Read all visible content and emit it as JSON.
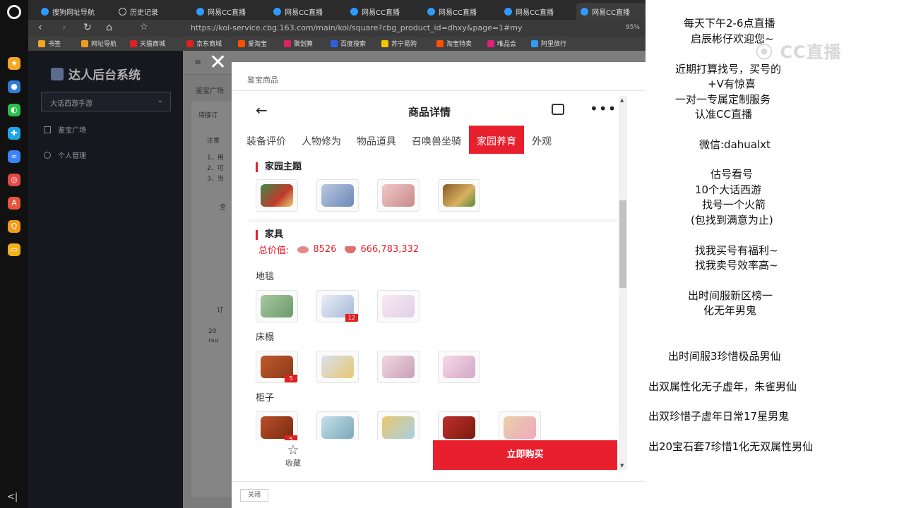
{
  "dock": {
    "apps": [
      {
        "name": "app-orange-icon",
        "color": "#f5a623"
      },
      {
        "name": "app-blue-icon",
        "color": "#2f7dd8"
      },
      {
        "name": "app-wechat-icon",
        "color": "#2bbf4b"
      },
      {
        "name": "app-cyan-icon",
        "color": "#1ea7e8"
      },
      {
        "name": "app-blue2-icon",
        "color": "#3b82f6"
      },
      {
        "name": "app-red-icon",
        "color": "#e54646"
      },
      {
        "name": "app-pdf-icon",
        "color": "#e5533c"
      },
      {
        "name": "app-search-icon",
        "color": "#f29b1a"
      },
      {
        "name": "app-folder-icon",
        "color": "#f2b01a"
      }
    ],
    "collapse": "<|"
  },
  "browser": {
    "tabs": [
      "搜狗网址导航",
      "历史记录",
      "网易CC直播",
      "网易CC直播",
      "网易CC直播",
      "网易CC直播",
      "网易CC直播",
      "网易CC直播"
    ],
    "url": "https://kol-service.cbg.163.com/main/kol/square?cbg_product_id=dhxy&page=1#my",
    "zoom": "95%",
    "bookmarks": [
      {
        "label": "书签",
        "color": "#f5a623"
      },
      {
        "label": "网址导航",
        "color": "#f29b1a"
      },
      {
        "label": "天猫商城",
        "color": "#e02020"
      },
      {
        "label": "京东商城",
        "color": "#e02020"
      },
      {
        "label": "爱淘宝",
        "color": "#ff5000"
      },
      {
        "label": "聚划算",
        "color": "#e02060"
      },
      {
        "label": "百度搜索",
        "color": "#3060e0"
      },
      {
        "label": "苏宁易购",
        "color": "#f5c400"
      },
      {
        "label": "淘宝特卖",
        "color": "#ff5000"
      },
      {
        "label": "唯品会",
        "color": "#e0207a"
      },
      {
        "label": "阿里旅行",
        "color": "#2f9bff"
      }
    ]
  },
  "sidebar": {
    "title": "达人后台系统",
    "select": "大话西游手游",
    "items": [
      "鉴宝广场",
      "个人管理"
    ]
  },
  "content": {
    "menu_icon": "≡",
    "breadcrumb": "鉴宝广场",
    "card_texts": [
      "待接订",
      "注意",
      "1、用",
      "2、可",
      "3、当",
      "全",
      "订",
      "20",
      "rsu"
    ]
  },
  "modal": {
    "title": "鉴宝商品",
    "close": "关闭",
    "close_x": "✕"
  },
  "phone": {
    "back": "←",
    "title": "商品详情",
    "more": "•••",
    "tabs": [
      "装备评价",
      "人物修为",
      "物品道具",
      "召唤兽坐骑",
      "家园养育",
      "外观"
    ],
    "active_tab": "家园养育",
    "sections": {
      "home_theme": "家园主题",
      "furniture": "家具"
    },
    "total_label": "总价值:",
    "total_value_1": "8526",
    "total_value_2": "666,783,332",
    "subcategories": [
      "地毯",
      "床榻",
      "柜子"
    ],
    "badges": {
      "carpet": "12",
      "bed": "5",
      "cabinet": "5"
    },
    "fav_label": "收藏",
    "fav_icon": "☆",
    "buy_label": "立即购买"
  },
  "overlay": {
    "lines": [
      "每天下午2-6点直播",
      "启辰彬仔欢迎您~",
      "近期打算找号，买号的",
      "+V有惊喜",
      "一对一专属定制服务",
      "认准CC直播",
      "微信:dahualxt",
      "估号看号",
      "10个大话西游",
      "找号一个火箭",
      "(包找到满意为止)",
      "找我买号有福利~",
      "找我卖号效率高~",
      "出时间服新区榜一",
      "化无年男鬼",
      "出时间服3珍惜极品男仙",
      "出双属性化无子虚年，朱雀男仙",
      "出双珍惜子虚年日常17星男鬼",
      "出20宝石套7珍惜1化无双属性男仙"
    ],
    "watermark": "CC直播"
  }
}
